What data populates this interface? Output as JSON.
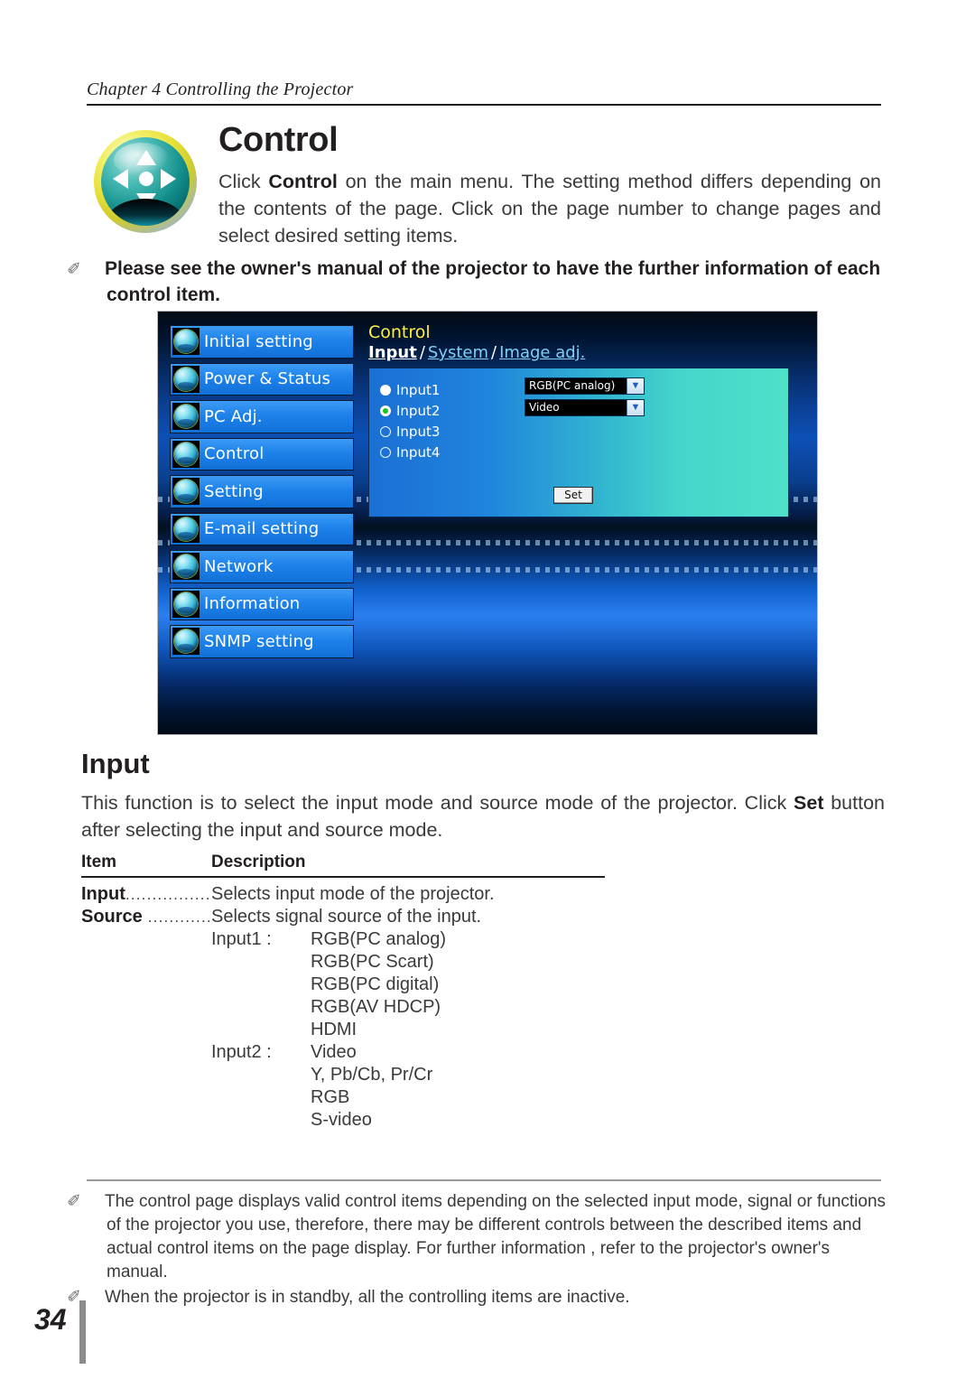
{
  "header": {
    "chapter": "Chapter 4 Controlling the Projector"
  },
  "section": {
    "icon": "control-direction-pad-icon",
    "title": "Control",
    "body_prefix": "Click ",
    "body_bold": "Control",
    "body_suffix": " on the main menu. The setting method differs depending on the contents of the page. Click on the page number to change pages and select desired setting items."
  },
  "notice": {
    "bullet": "✐",
    "text": "Please see the owner's manual of the projector to have the further information of each control item."
  },
  "screenshot": {
    "menu": [
      {
        "label": "Initial setting",
        "icon": "initial-setting-orb-icon"
      },
      {
        "label": "Power & Status",
        "icon": "power-status-orb-icon"
      },
      {
        "label": "PC Adj.",
        "icon": "pc-adj-orb-icon"
      },
      {
        "label": "Control",
        "icon": "control-orb-icon"
      },
      {
        "label": "Setting",
        "icon": "setting-orb-icon"
      },
      {
        "label": "E-mail setting",
        "icon": "email-orb-icon"
      },
      {
        "label": "Network",
        "icon": "network-orb-icon"
      },
      {
        "label": "Information",
        "icon": "information-orb-icon"
      },
      {
        "label": "SNMP setting",
        "icon": "snmp-orb-icon"
      }
    ],
    "panel_title": "Control",
    "tabs": [
      {
        "label": "Input",
        "active": true
      },
      {
        "label": "System",
        "active": false
      },
      {
        "label": "Image adj.",
        "active": false
      }
    ],
    "tab_separator": "/",
    "inputs": [
      {
        "label": "Input1",
        "state": "filled"
      },
      {
        "label": "Input2",
        "state": "selected"
      },
      {
        "label": "Input3",
        "state": "empty"
      },
      {
        "label": "Input4",
        "state": "empty"
      }
    ],
    "selects": [
      {
        "value": "RGB(PC analog)",
        "arrow": "chevron-down-icon"
      },
      {
        "value": "Video",
        "arrow": "chevron-down-icon"
      }
    ],
    "set_button": "Set",
    "colors": {
      "panel_left": "#1b6fd4",
      "panel_right": "#4ee0c9",
      "menu_blue": "#1d82ea",
      "title_yellow": "#ffef3a",
      "selected_radio_green": "#19c421"
    }
  },
  "input_section": {
    "title": "Input",
    "body_prefix": "This function is to select the input mode and source mode of the projector.  Click ",
    "body_bold": "Set",
    "body_suffix": " button after selecting the input and source mode."
  },
  "table": {
    "headers": {
      "item": "Item",
      "description": "Description"
    },
    "rows": [
      {
        "item": "Input",
        "dots": "........................",
        "description": "Selects input mode of the projector."
      },
      {
        "item": "Source",
        "dots": " ....................",
        "description": "Selects signal source of the input."
      }
    ],
    "option_groups": [
      {
        "key": "Input1 :",
        "values": [
          "RGB(PC analog)",
          "RGB(PC Scart)",
          "RGB(PC digital)",
          "RGB(AV HDCP)",
          "HDMI"
        ]
      },
      {
        "key": "Input2 :",
        "values": [
          "Video",
          "Y, Pb/Cb, Pr/Cr",
          "RGB",
          "S-video"
        ]
      }
    ]
  },
  "footer": {
    "bullet": "✐",
    "notes": [
      "The control page displays valid control items depending on the selected input mode, signal or  functions of the projector you use, therefore, there may be different controls between the described items and actual control items on the page display. For further information , refer to the projector's owner's manual.",
      "When the projector is in standby, all the controlling items are inactive."
    ],
    "page_number": "34"
  }
}
